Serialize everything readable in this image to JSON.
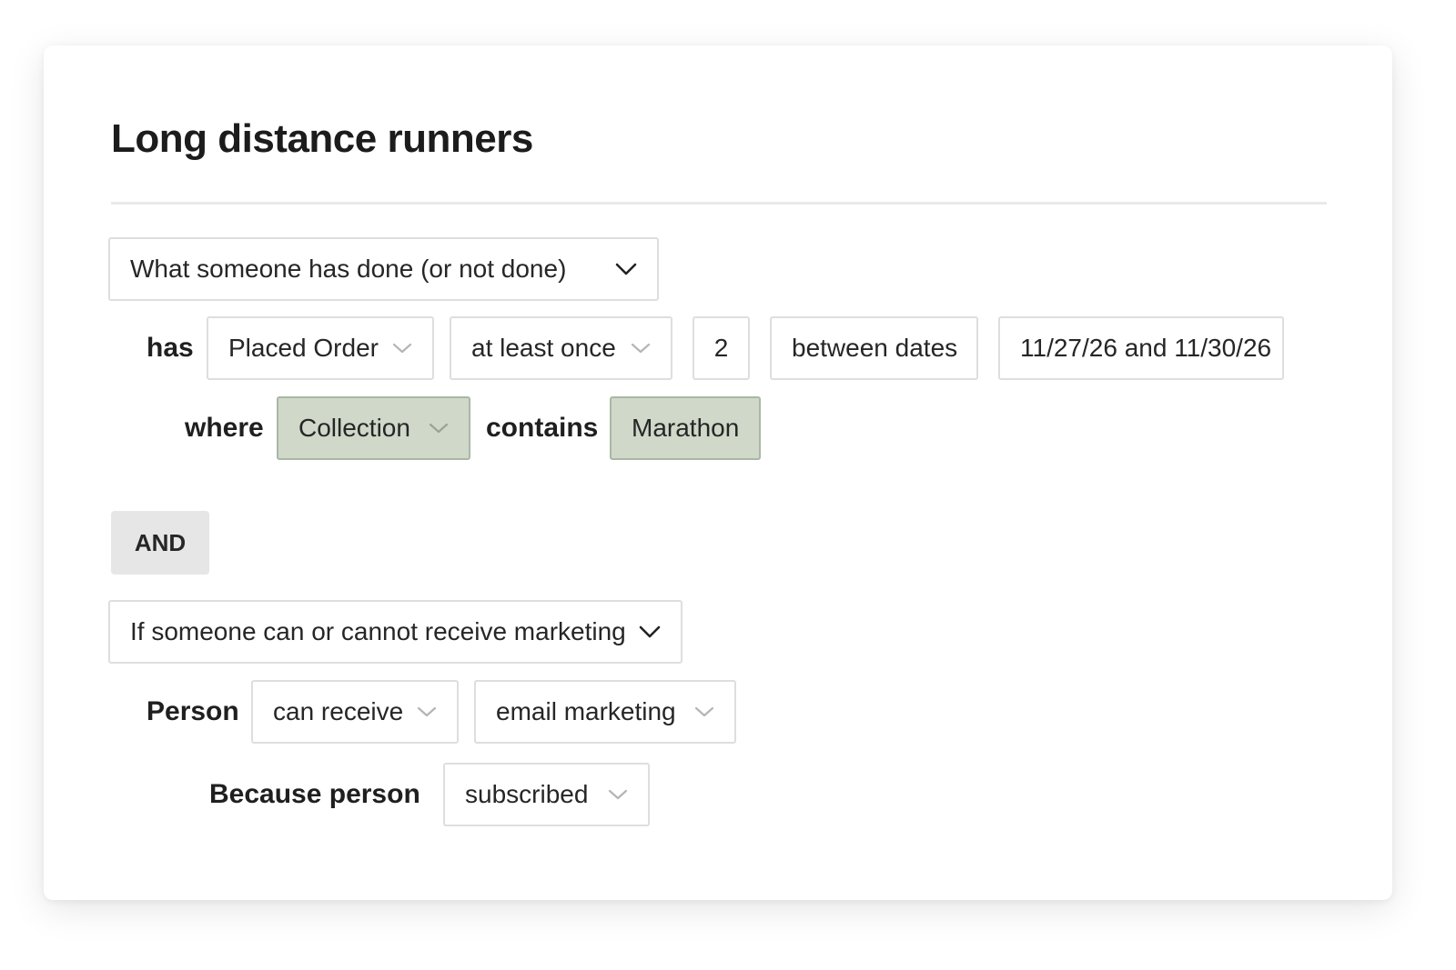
{
  "segment": {
    "title": "Long distance runners"
  },
  "condition1": {
    "type_label": "What someone has done (or not done)",
    "has_label": "has",
    "metric": "Placed Order",
    "frequency": "at least once",
    "count": "2",
    "timeframe": "between dates",
    "date_range": "11/27/26 and 11/30/26",
    "where_label": "where",
    "property": "Collection",
    "operator_label": "contains",
    "value": "Marathon"
  },
  "and_label": "AND",
  "condition2": {
    "type_label": "If someone can or cannot receive marketing",
    "person_label": "Person",
    "permission": "can receive",
    "channel": "email marketing",
    "because_label": "Because person",
    "reason": "subscribed"
  },
  "icons": {
    "dropdown": "chevron-down-icon"
  },
  "colors": {
    "highlight_bg": "#cfd8c9",
    "highlight_border": "#aab7a4",
    "and_bg": "#e6e6e6"
  }
}
